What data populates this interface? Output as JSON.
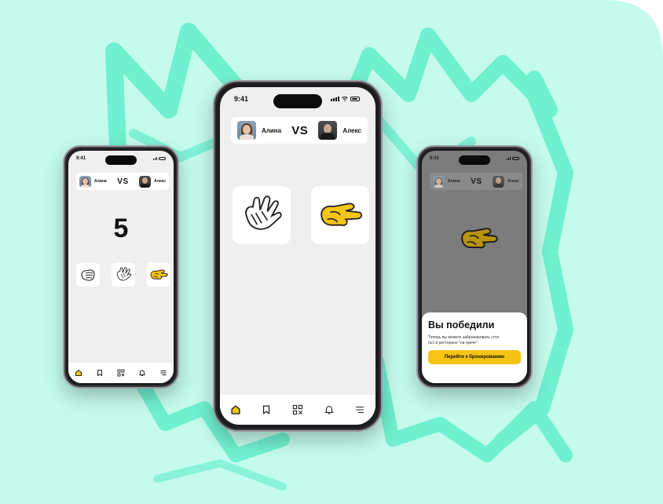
{
  "colors": {
    "background_mint": "#c4fbec",
    "brush_mint": "#6ff0cf",
    "screen_bg": "#efefef",
    "accent_yellow": "#f5c414",
    "overlay": "#3c3c3c"
  },
  "phones": {
    "left": {
      "status_time": "9:41",
      "player_left": "Алина",
      "vs": "VS",
      "player_right": "Алекс",
      "countdown": "5",
      "hands": [
        "rock-hand-icon",
        "paper-hand-icon",
        "scissors-hand-icon"
      ],
      "tabs": [
        "home-icon",
        "bookmark-icon",
        "qr-icon",
        "bell-icon",
        "menu-icon"
      ]
    },
    "center": {
      "status_time": "9:41",
      "player_left": "Алина",
      "vs": "VS",
      "player_right": "Алекс",
      "my_choice": "paper-hand-icon",
      "opponent_choice": "scissors-hand-icon",
      "tabs": [
        "home-icon",
        "bookmark-icon",
        "qr-icon",
        "bell-icon",
        "menu-icon"
      ]
    },
    "right": {
      "status_time": "9:41",
      "player_left": "Алина",
      "vs": "VS",
      "player_right": "Алекс",
      "result_hand": "scissors-hand-icon",
      "result_title": "Вы победили",
      "result_text": "Теперь вы можете забронировать стол №1 в ресторане \"на гриле\"",
      "cta_label": "Перейти к бронированию"
    }
  }
}
